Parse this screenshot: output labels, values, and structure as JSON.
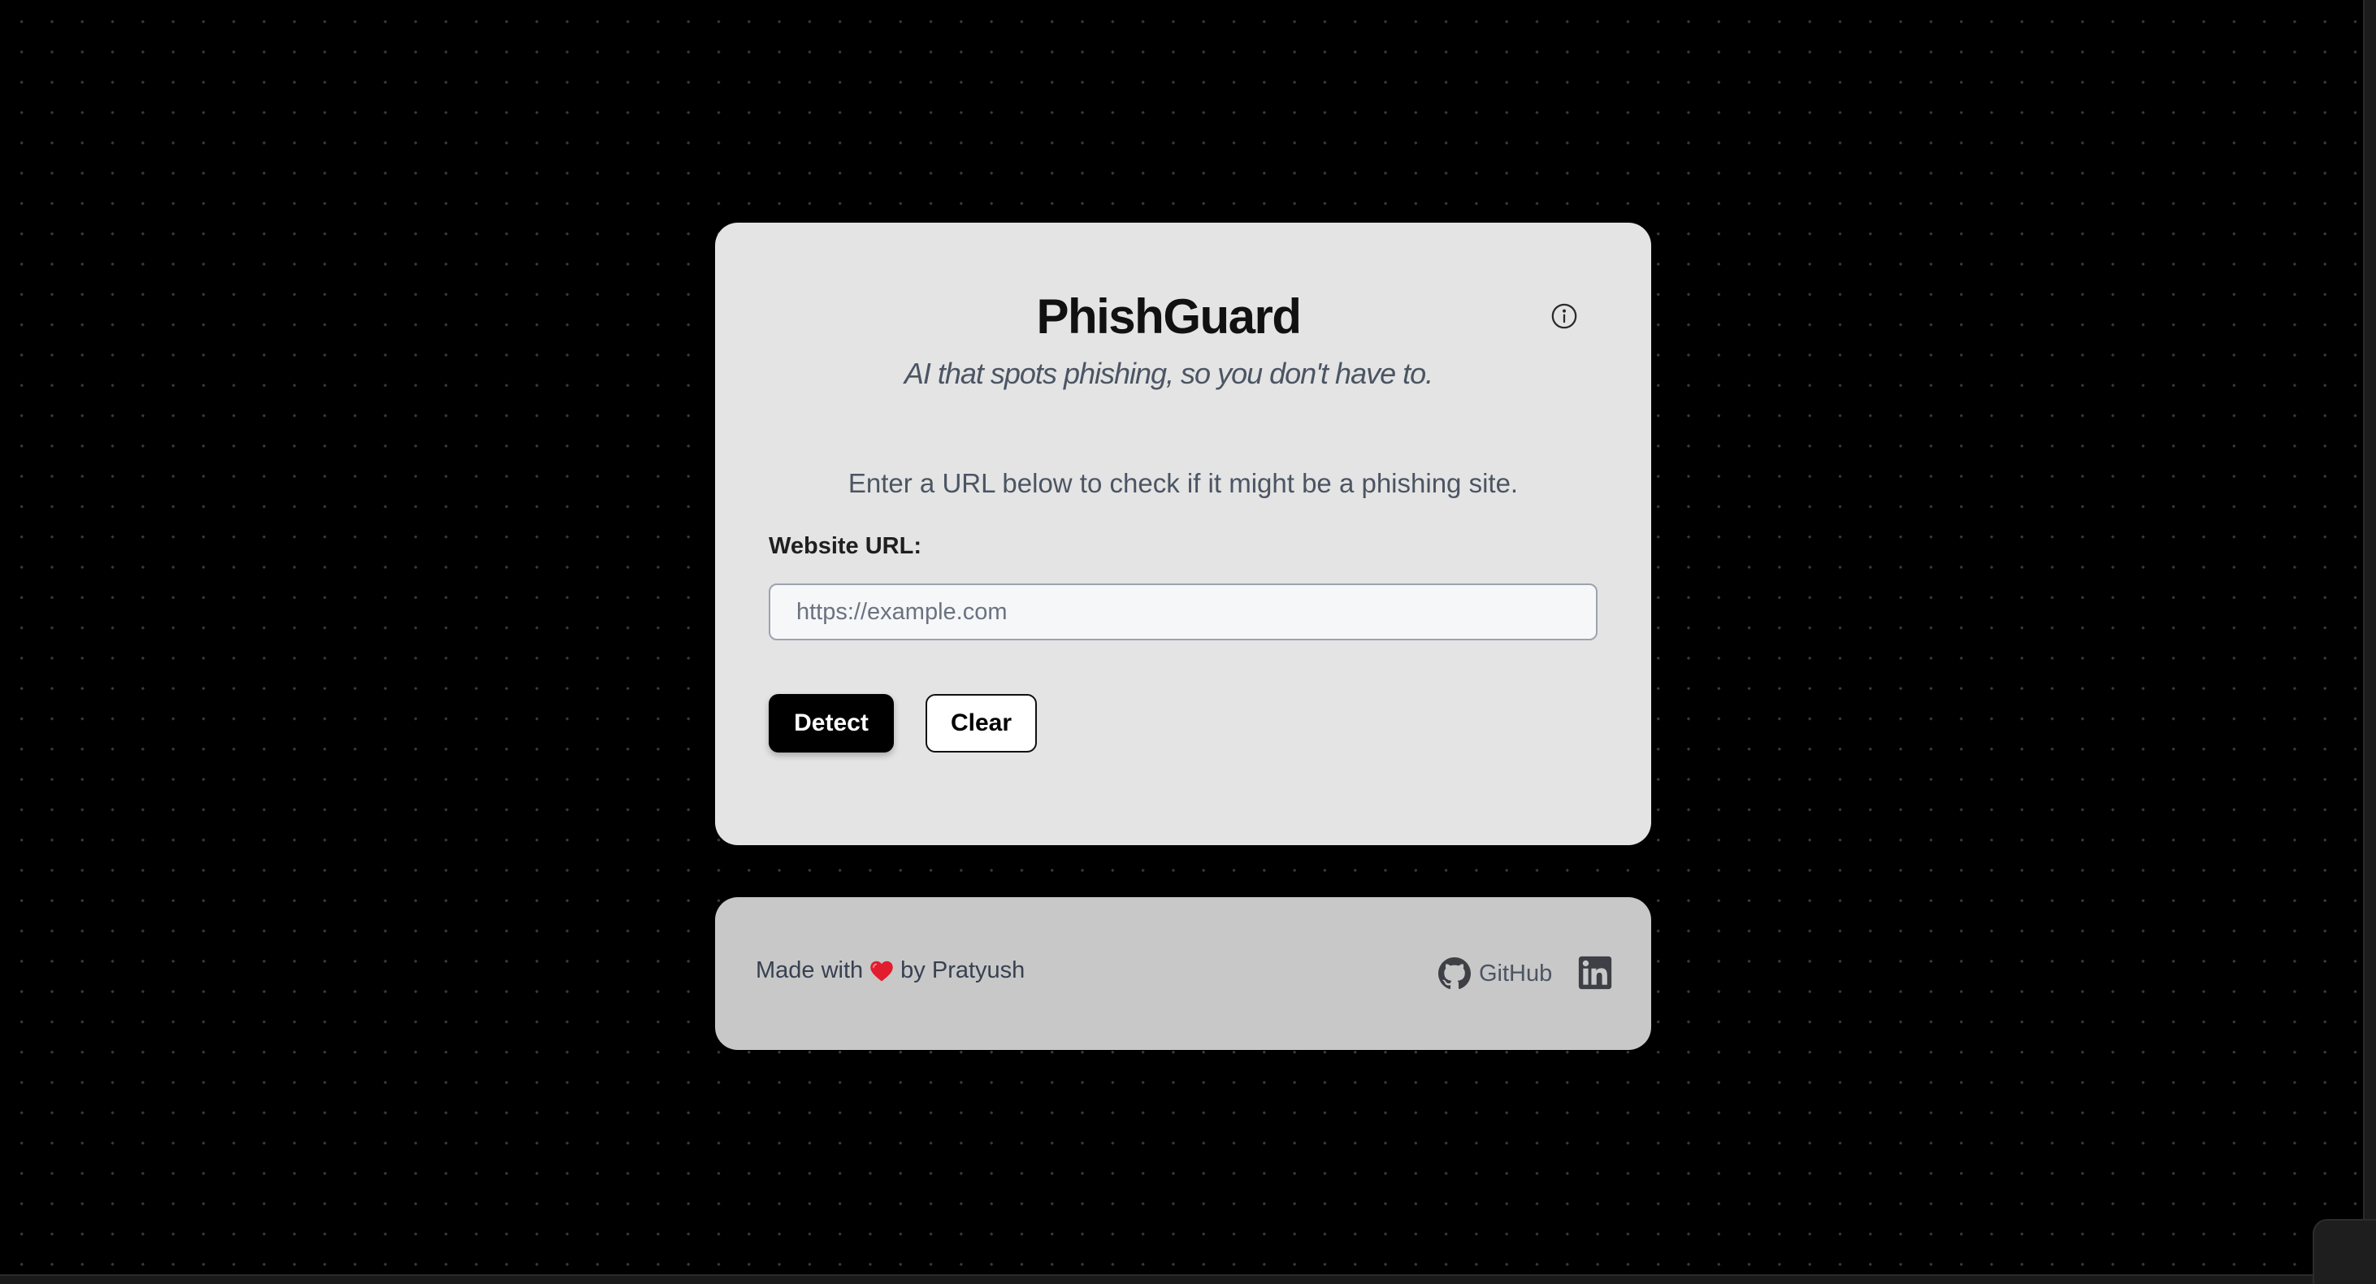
{
  "app": {
    "title": "PhishGuard",
    "tagline": "AI that spots phishing, so you don't have to.",
    "info_icon": "info-icon"
  },
  "form": {
    "intro": "Enter a URL below to check if it might be a phishing site.",
    "url_label": "Website URL:",
    "url_placeholder": "https://example.com",
    "url_value": "",
    "detect_label": "Detect",
    "clear_label": "Clear"
  },
  "footer": {
    "made_with_prefix": "Made with",
    "heart_icon": "heart-icon",
    "made_with_suffix": "by Pratyush",
    "github_label": "GitHub",
    "github_icon": "github-icon",
    "linkedin_icon": "linkedin-icon"
  },
  "colors": {
    "background": "#000000",
    "card": "#e4e4e4",
    "footer": "#c8c8c8",
    "primary_button": "#000000",
    "heart": "#e11d2e"
  }
}
